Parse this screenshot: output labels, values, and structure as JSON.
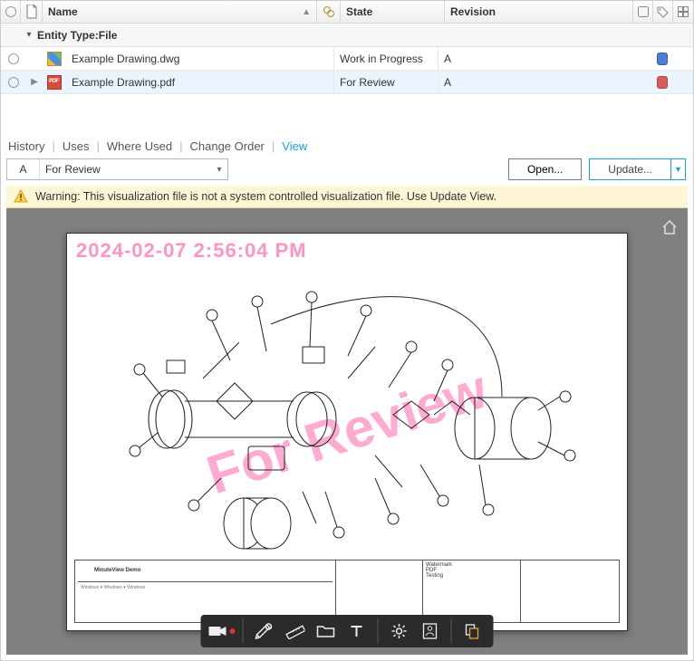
{
  "columns": {
    "name": "Name",
    "state": "State",
    "revision": "Revision"
  },
  "group": {
    "label": "Entity Type:File"
  },
  "rows": [
    {
      "name": "Example Drawing.dwg",
      "state": "Work in Progress",
      "rev": "A",
      "icon": "dwg",
      "chip": "blue",
      "active": false
    },
    {
      "name": "Example Drawing.pdf",
      "state": "For Review",
      "rev": "A",
      "icon": "pdf",
      "chip": "red",
      "active": true
    }
  ],
  "tabs": {
    "history": "History",
    "uses": "Uses",
    "whereused": "Where Used",
    "co": "Change Order",
    "view": "View"
  },
  "revbar": {
    "rev": "A",
    "state": "For Review",
    "open": "Open...",
    "update": "Update..."
  },
  "warning": "Warning: This visualization file is not a system controlled visualization file. Use Update View.",
  "page": {
    "timestamp": "2024-02-07 2:56:04 PM",
    "watermark": "For Review",
    "tb_title": "MinuteView Demo",
    "tb_wm": "Watermark",
    "tb_fmt": "PDF",
    "tb_test": "Testing"
  }
}
